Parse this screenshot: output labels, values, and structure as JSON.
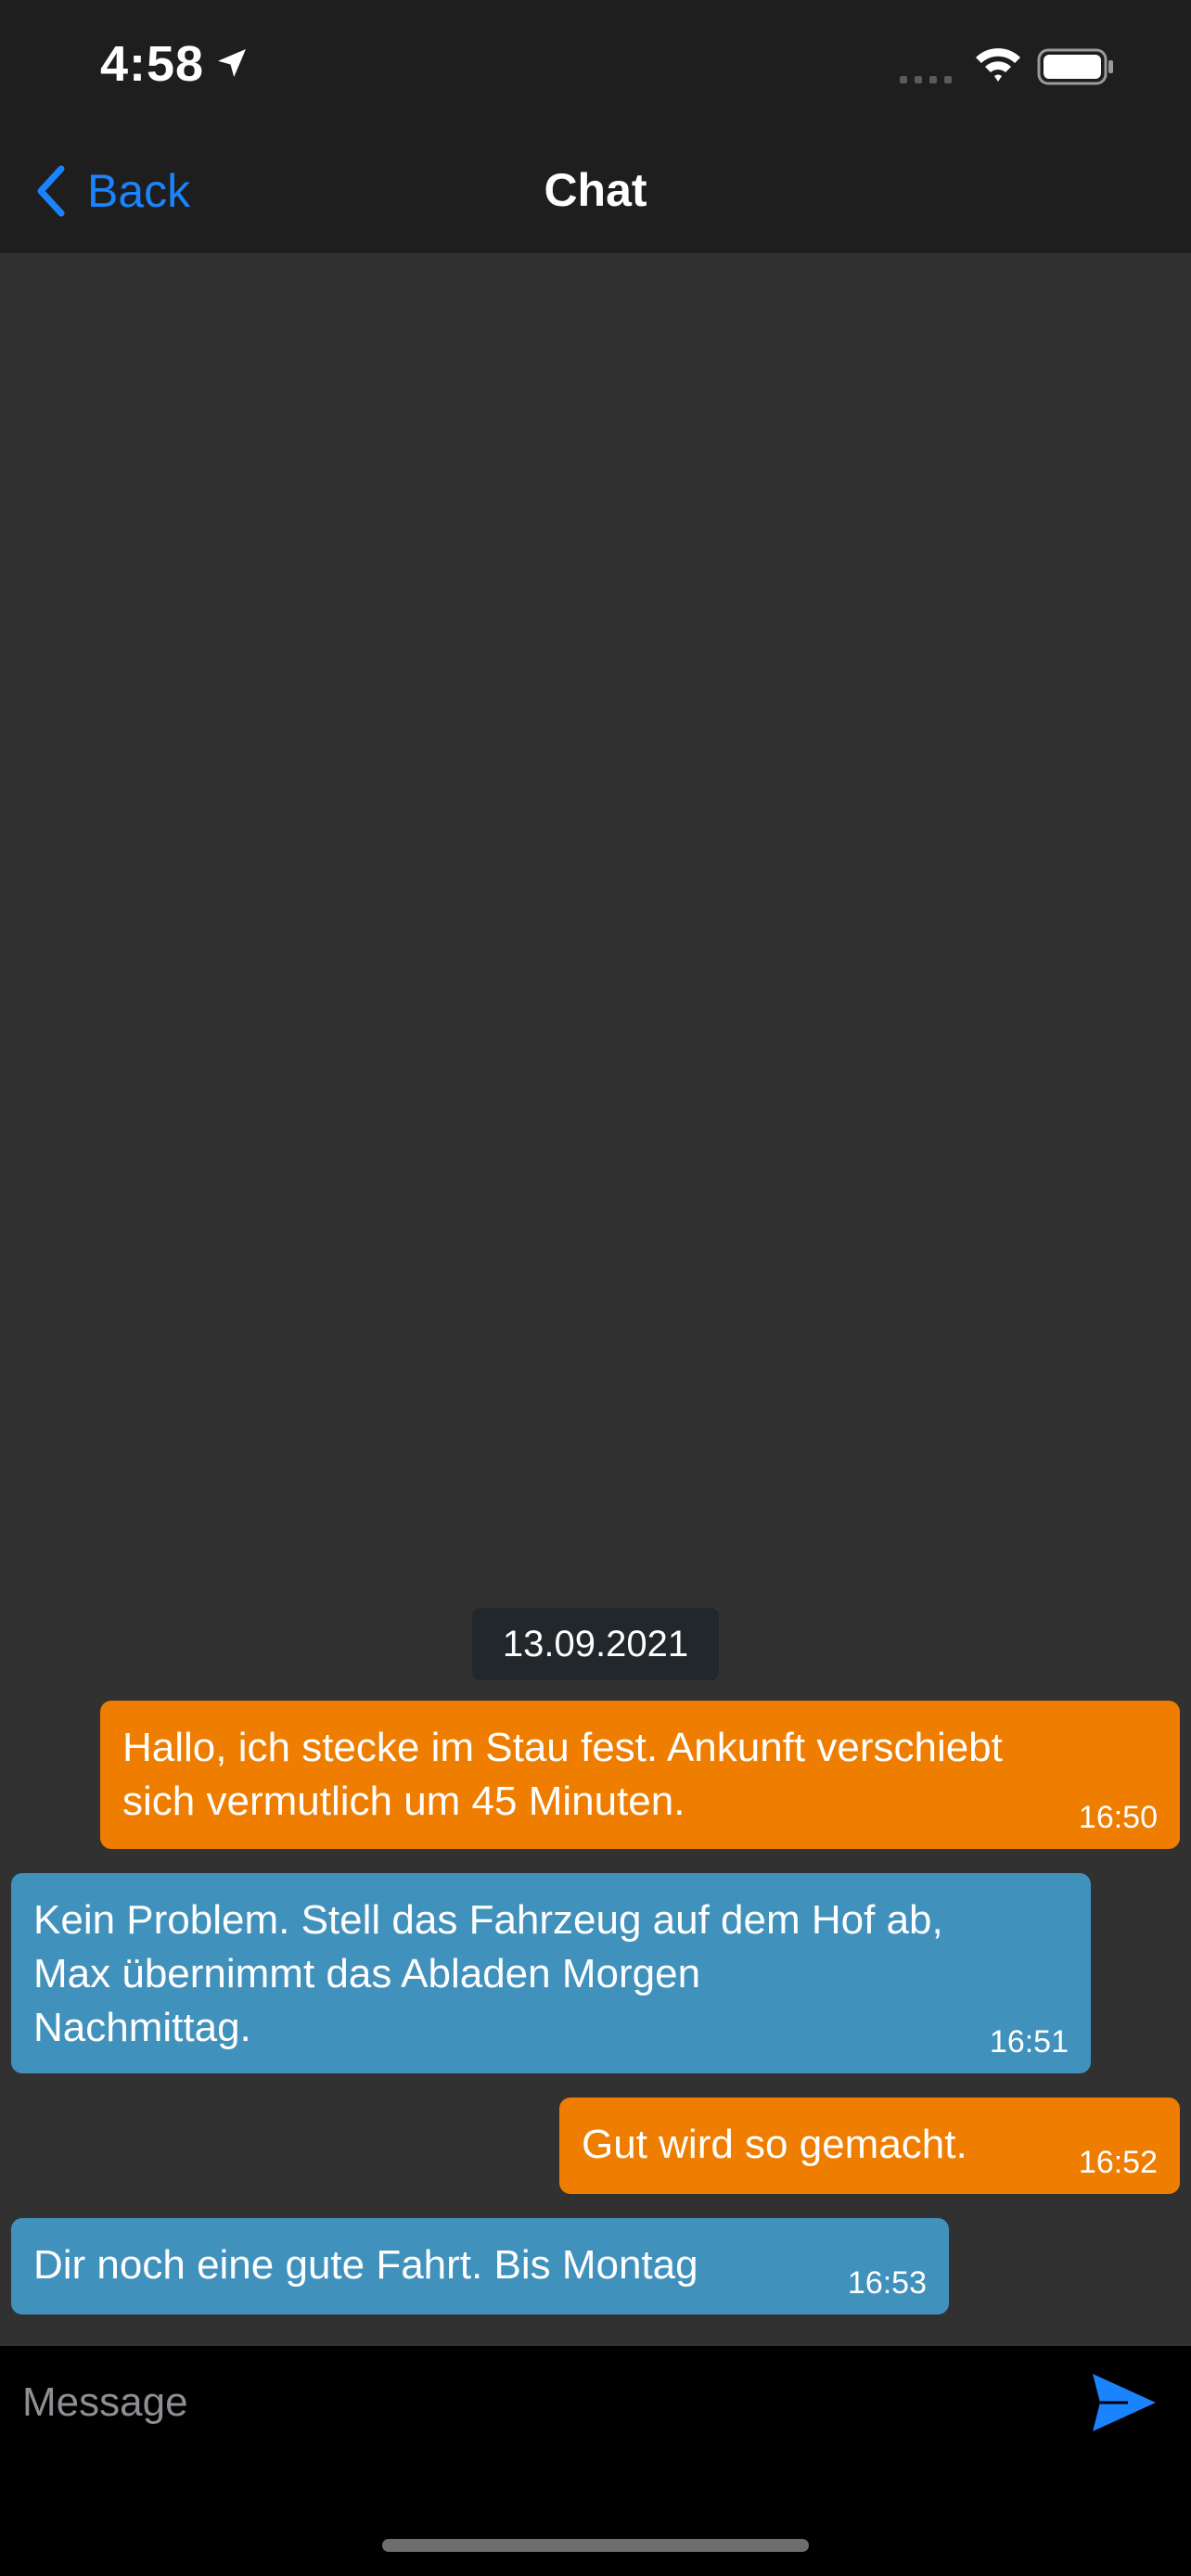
{
  "status_bar": {
    "time": "4:58",
    "icons": [
      "location-arrow-icon",
      "cellular-signal-icon",
      "wifi-icon",
      "battery-icon"
    ]
  },
  "nav": {
    "back_label": "Back",
    "title": "Chat"
  },
  "chat": {
    "date_separator": "13.09.2021",
    "messages": [
      {
        "direction": "outgoing",
        "text": "Hallo, ich stecke im Stau fest. Ankunft verschiebt\nsich vermutlich um 45 Minuten.",
        "time": "16:50"
      },
      {
        "direction": "incoming",
        "text": "Kein Problem. Stell das Fahrzeug auf dem Hof ab,\nMax übernimmt das Abladen Morgen\nNachmittag.",
        "time": "16:51"
      },
      {
        "direction": "outgoing",
        "text": "Gut wird so gemacht.",
        "time": "16:52"
      },
      {
        "direction": "incoming",
        "text": "Dir noch eine gute Fahrt. Bis Montag",
        "time": "16:53"
      }
    ]
  },
  "composer": {
    "placeholder": "Message",
    "value": "",
    "send_icon": "send-icon"
  },
  "colors": {
    "background": "#313131",
    "nav_background": "#1e1e1e",
    "accent": "#1a84ff",
    "outgoing_bubble": "#ee7d00",
    "incoming_bubble": "#4191bd",
    "date_chip": "#22272c",
    "input_bar": "#000000"
  }
}
